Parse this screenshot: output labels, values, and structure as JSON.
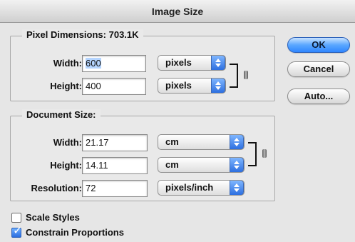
{
  "window": {
    "title": "Image Size"
  },
  "pixel_dimensions": {
    "title": "Pixel Dimensions:",
    "size": "703.1K",
    "width_label": "Width:",
    "width_value": "600",
    "width_unit": "pixels",
    "height_label": "Height:",
    "height_value": "400",
    "height_unit": "pixels"
  },
  "document_size": {
    "title": "Document Size:",
    "width_label": "Width:",
    "width_value": "21.17",
    "width_unit": "cm",
    "height_label": "Height:",
    "height_value": "14.11",
    "height_unit": "cm",
    "resolution_label": "Resolution:",
    "resolution_value": "72",
    "resolution_unit": "pixels/inch"
  },
  "buttons": {
    "ok": "OK",
    "cancel": "Cancel",
    "auto": "Auto..."
  },
  "options": {
    "scale_styles": {
      "label": "Scale Styles",
      "checked": false
    },
    "constrain_proportions": {
      "label": "Constrain Proportions",
      "checked": true
    }
  },
  "icons": {
    "select_arrows": "up-down-arrows-icon",
    "checkmark": "checkmark-icon",
    "link": "link-bracket-icon",
    "chain": "chain-icon"
  }
}
